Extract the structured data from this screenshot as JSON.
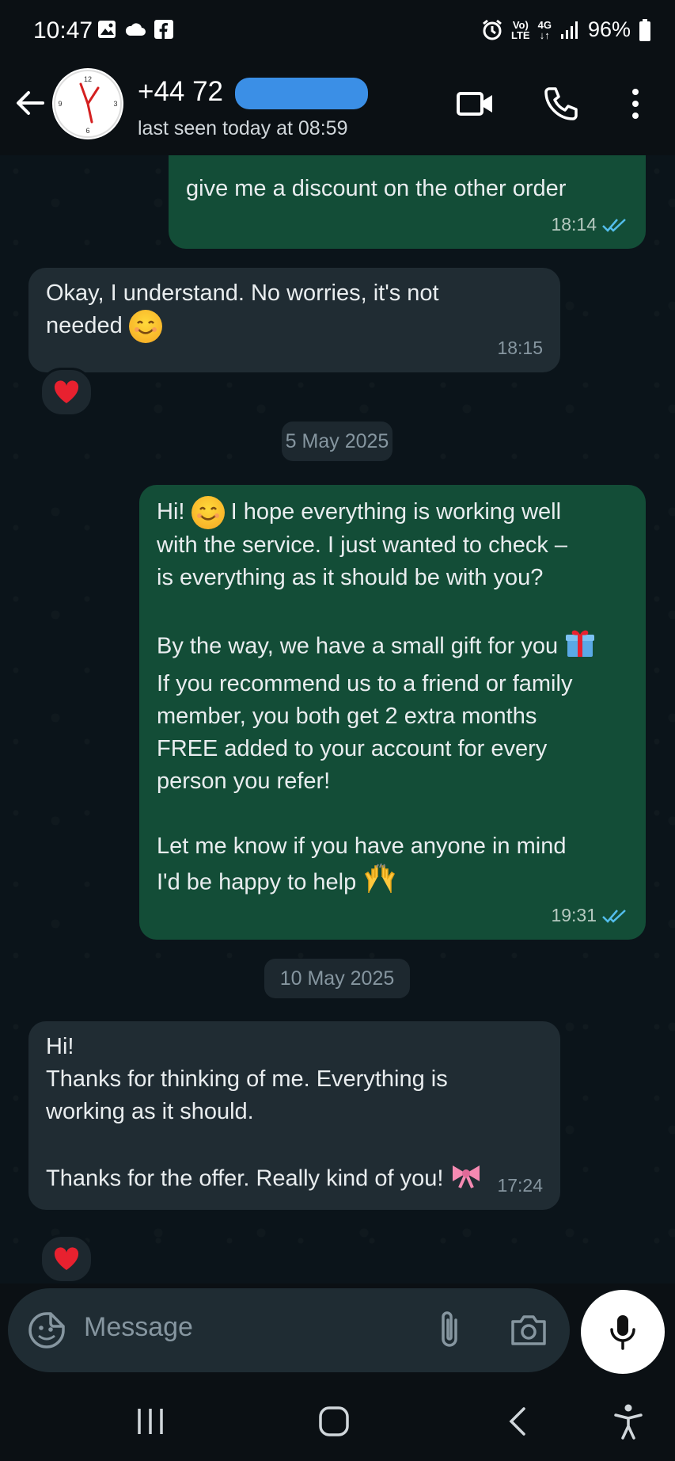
{
  "status_bar": {
    "time": "10:47",
    "battery": "96%",
    "volte_top": "Vo)",
    "volte_bottom": "LTE",
    "network": "4G"
  },
  "header": {
    "contact_name": "+44 72",
    "last_seen": "last seen today at 08:59"
  },
  "messages": [
    {
      "id": "m1",
      "direction": "outgoing",
      "text": "give me a discount on the other order",
      "time": "18:14"
    },
    {
      "id": "m2",
      "direction": "incoming",
      "text": "Okay, I understand. No worries, it's not",
      "text2": "needed",
      "time": "18:15",
      "reaction": "heart"
    },
    {
      "id": "d1",
      "date": "5 May 2025"
    },
    {
      "id": "m3",
      "direction": "outgoing",
      "line1_a": "Hi!",
      "line1_b": "I hope everything is working well",
      "para1": "with the service. I just wanted to check –\nis everything as it should be with you?",
      "line_gift": "By the way, we have a small gift for you",
      "para2": "If you recommend us to a friend or family\nmember, you both get 2 extra months\nFREE added to your account for every\nperson you refer!",
      "line_mind": "Let me know if you have anyone in mind",
      "line_help": "I'd be happy to help",
      "time": "19:31"
    },
    {
      "id": "d2",
      "date": "10 May 2025"
    },
    {
      "id": "m4",
      "direction": "incoming",
      "text": "Hi!\nThanks for thinking of me. Everything is\nworking as it should.",
      "text_last": "Thanks for the offer. Really kind of you!",
      "time": "17:24",
      "reaction": "heart"
    }
  ],
  "composer": {
    "placeholder": "Message"
  },
  "colors": {
    "outgoing_bubble": "#134d37",
    "incoming_bubble": "#202c33",
    "read_ticks": "#53bdeb"
  }
}
